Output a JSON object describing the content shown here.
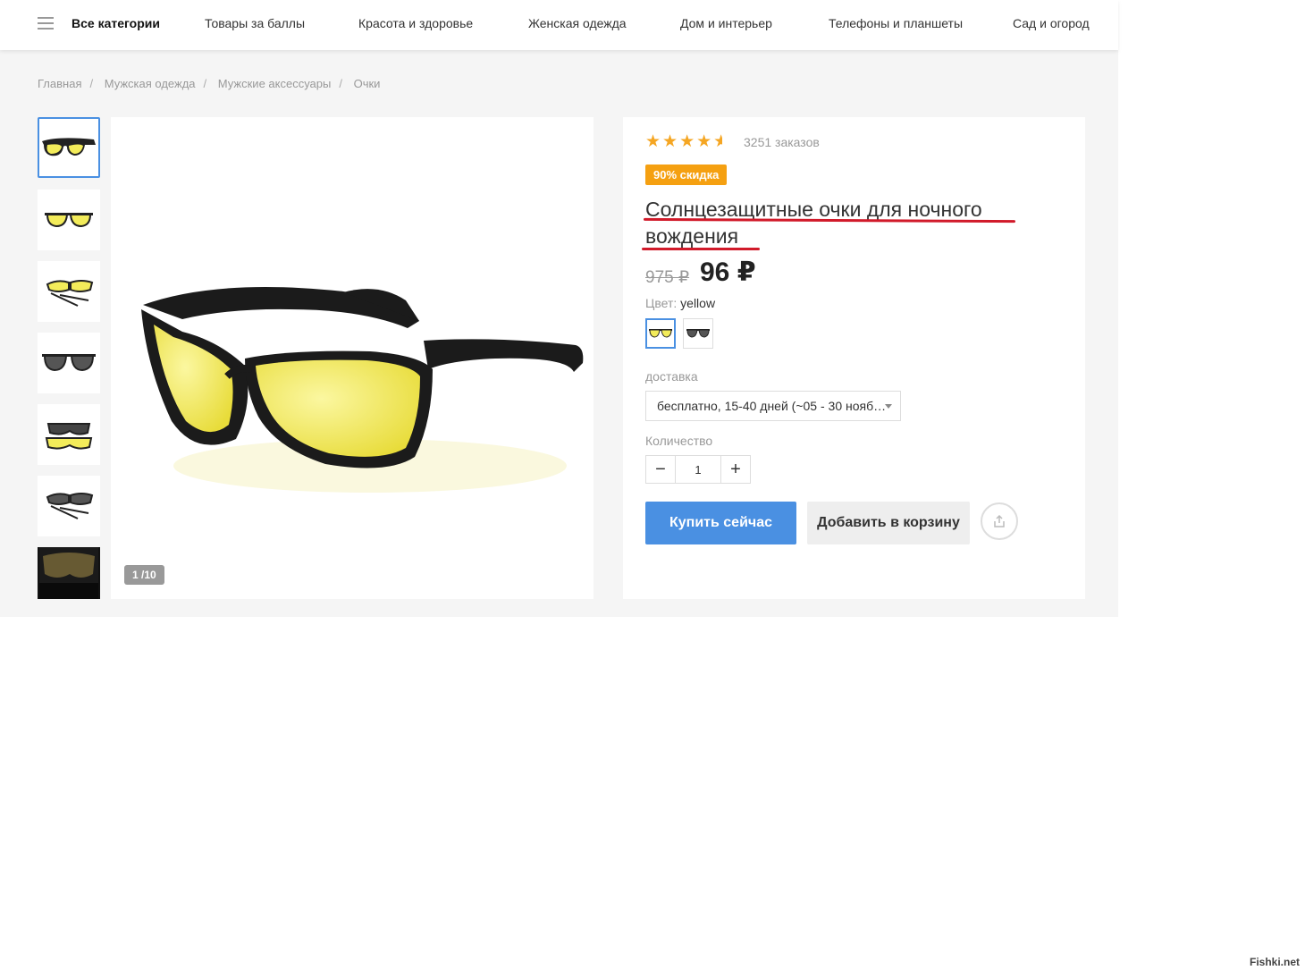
{
  "nav": {
    "items": [
      "Все категории",
      "Товары за баллы",
      "Красота и здоровье",
      "Женская одежда",
      "Дом и интерьер",
      "Телефоны и планшеты",
      "Сад и огород"
    ]
  },
  "breadcrumb": [
    "Главная",
    "Мужская одежда",
    "Мужские аксессуары",
    "Очки"
  ],
  "gallery": {
    "counter": "1 /10",
    "thumbnails": [
      "yellow-glasses",
      "yellow-glasses-front",
      "yellow-glasses-folded",
      "dark-glasses",
      "yellow-and-dark-glasses",
      "dark-glasses-folded",
      "night-view-photo"
    ]
  },
  "product": {
    "rating": 4.5,
    "orders": "3251 заказов",
    "discount_badge": "90% скидка",
    "title": "Солнцезащитные очки для ночного вождения",
    "old_price": "975 ₽",
    "price": "96 ₽",
    "color_label": "Цвет:",
    "color_value": "yellow",
    "color_options": [
      "yellow",
      "black"
    ],
    "delivery_label": "доставка",
    "delivery_value": "бесплатно, 15-40 дней (~05 - 30 нояб…",
    "quantity_label": "Количество",
    "quantity": "1",
    "buy_label": "Купить сейчас",
    "cart_label": "Добавить в корзину"
  },
  "colors": {
    "accent": "#4a90e2",
    "badge": "#f5a011",
    "star": "#f5a623",
    "underline": "#d11a2a",
    "lens": "#f3ec5a"
  },
  "watermark": "Fishki.net"
}
